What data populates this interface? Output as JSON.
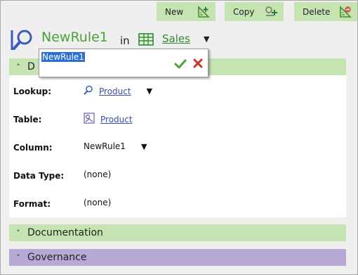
{
  "toolbar": {
    "new_label": "New",
    "copy_label": "Copy",
    "delete_label": "Delete"
  },
  "header": {
    "rule_name": "NewRule1",
    "in_word": "in",
    "table_name": "Sales"
  },
  "rename": {
    "value": "NewRule1"
  },
  "sections": {
    "details_label": "D",
    "documentation_label": "Documentation",
    "governance_label": "Governance"
  },
  "properties": {
    "lookup": {
      "label": "Lookup:",
      "value": "Product"
    },
    "table": {
      "label": "Table:",
      "value": "Product"
    },
    "column": {
      "label": "Column:",
      "value": "NewRule1"
    },
    "data_type": {
      "label": "Data Type:",
      "value": "(none)"
    },
    "format": {
      "label": "Format:",
      "value": "(none)"
    }
  },
  "colors": {
    "accent_green": "#4aa33a",
    "section_green": "#c6e3b2",
    "section_purple": "#b8a8d6",
    "link_blue": "#3b4fa6"
  },
  "icons": {
    "new": "ruler-plus-icon",
    "copy": "copy-icon",
    "delete": "ruler-minus-icon",
    "lookup": "magnifier-icon",
    "table": "table-grid-icon",
    "confirm": "check-icon",
    "cancel": "x-icon"
  }
}
